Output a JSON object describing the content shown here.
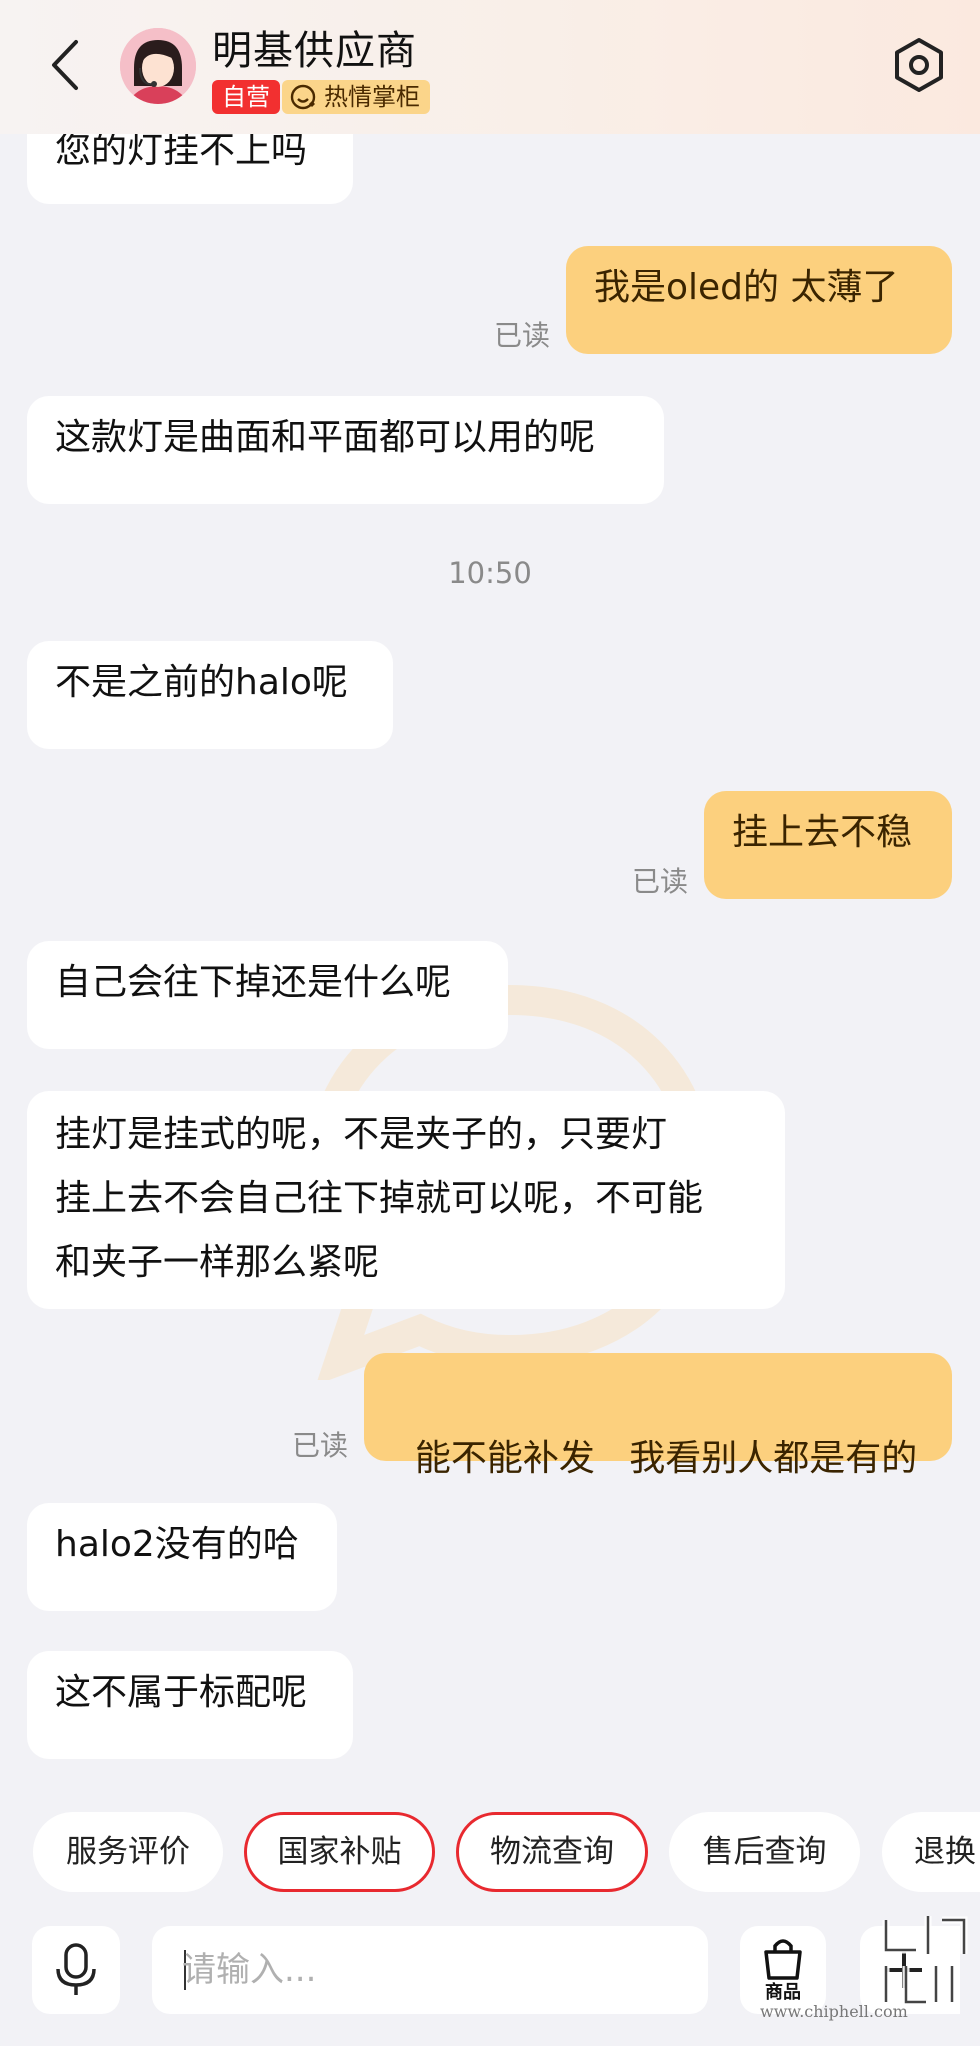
{
  "header": {
    "shop_name": "明基供应商",
    "badge_self": "自营",
    "badge_warm": "热情掌柜"
  },
  "messages": [
    {
      "text": "您的灯挂不上吗"
    },
    {
      "text": "我是oled的  太薄了",
      "read": "已读"
    },
    {
      "text": "这款灯是曲面和平面都可以用的呢"
    },
    {
      "text": "不是之前的halo呢"
    },
    {
      "text": "挂上去不稳",
      "read": "已读"
    },
    {
      "text": "自己会往下掉还是什么呢"
    },
    {
      "lines": [
        "挂灯是挂式的呢，不是夹子的，只要灯",
        "挂上去不会自己往下掉就可以呢，不可能",
        "和夹子一样那么紧呢"
      ]
    },
    {
      "text": "能不能补发   我看别人都是有的",
      "read": "已读"
    },
    {
      "text": "halo2没有的哈"
    },
    {
      "text": "这不属于标配呢"
    }
  ],
  "timestamp": "10:50",
  "quick_replies": [
    "服务评价",
    "国家补贴",
    "物流查询",
    "售后查询",
    "退换"
  ],
  "input": {
    "placeholder": "请输入..."
  },
  "goods_label": "商品",
  "site_watermark": "www.chiphell.com",
  "colors": {
    "outgoing_bubble": "#fcd07e",
    "incoming_bubble": "#ffffff",
    "accent_red": "#e8292f",
    "badge_gold": "#fbd58a"
  }
}
